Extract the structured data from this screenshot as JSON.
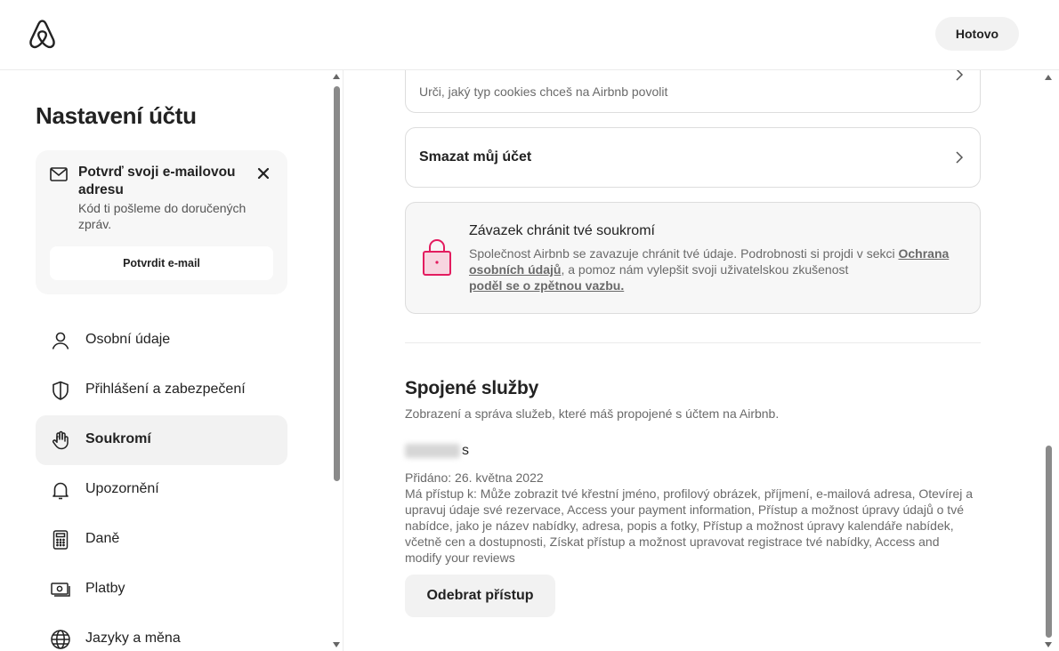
{
  "header": {
    "logo_icon": "airbnb-logo-icon",
    "done_label": "Hotovo"
  },
  "sidebar": {
    "title": "Nastavení účtu",
    "verify_card": {
      "title": "Potvrď svoji e-mailovou adresu",
      "subtitle": "Kód ti pošleme do doručených zpráv.",
      "button_label": "Potvrdit e-mail",
      "icon": "mail-icon",
      "close_icon": "close-icon"
    },
    "items": [
      {
        "label": "Osobní údaje",
        "icon": "person-icon",
        "active": false
      },
      {
        "label": "Přihlášení a zabezpečení",
        "icon": "shield-icon",
        "active": false
      },
      {
        "label": "Soukromí",
        "icon": "hand-icon",
        "active": true
      },
      {
        "label": "Upozornění",
        "icon": "bell-icon",
        "active": false
      },
      {
        "label": "Daně",
        "icon": "calculator-icon",
        "active": false
      },
      {
        "label": "Platby",
        "icon": "money-icon",
        "active": false
      },
      {
        "label": "Jazyky a měna",
        "icon": "globe-icon",
        "active": false
      }
    ]
  },
  "main": {
    "cookies_card": {
      "subtitle": "Urči, jaký typ cookies chceš na Airbnb povolit"
    },
    "delete_card": {
      "title": "Smazat můj účet"
    },
    "privacy_card": {
      "title": "Závazek chránit tvé soukromí",
      "body_prefix": "Společnost Airbnb se zavazuje chránit tvé údaje. Podrobnosti si projdi v sekci ",
      "body_link1": "Ochrana osobních údajů",
      "body_middle": ", a pomoz nám vylepšit svoji uživatelskou zkušenost ",
      "body_link2": "poděl se o zpětnou vazbu.",
      "icon": "lock-icon"
    },
    "connected": {
      "title": "Spojené služby",
      "subtitle": "Zobrazení a správa služeb, které máš propojené s účtem na Airbnb.",
      "service_name_suffix": "s",
      "added": "Přidáno: 26. května 2022",
      "access": "Má přístup k: Může zobrazit tvé křestní jméno, profilový obrázek, příjmení, e-mailová adresa, Otevírej a upravuj údaje své rezervace, Access your payment information, Přístup a možnost úpravy údajů o tvé nabídce, jako je název nabídky, adresa, popis a fotky, Přístup a možnost úpravy kalendáře nabídek, včetně cen a dostupnosti, Získat přístup a možnost upravovat registrace tvé nabídky, Access and modify your reviews",
      "revoke_label": "Odebrat přístup"
    }
  },
  "colors": {
    "brand": "#E31C5F",
    "text": "#222222",
    "muted": "#6A6A6A",
    "active_bg": "#F2F2F2"
  }
}
